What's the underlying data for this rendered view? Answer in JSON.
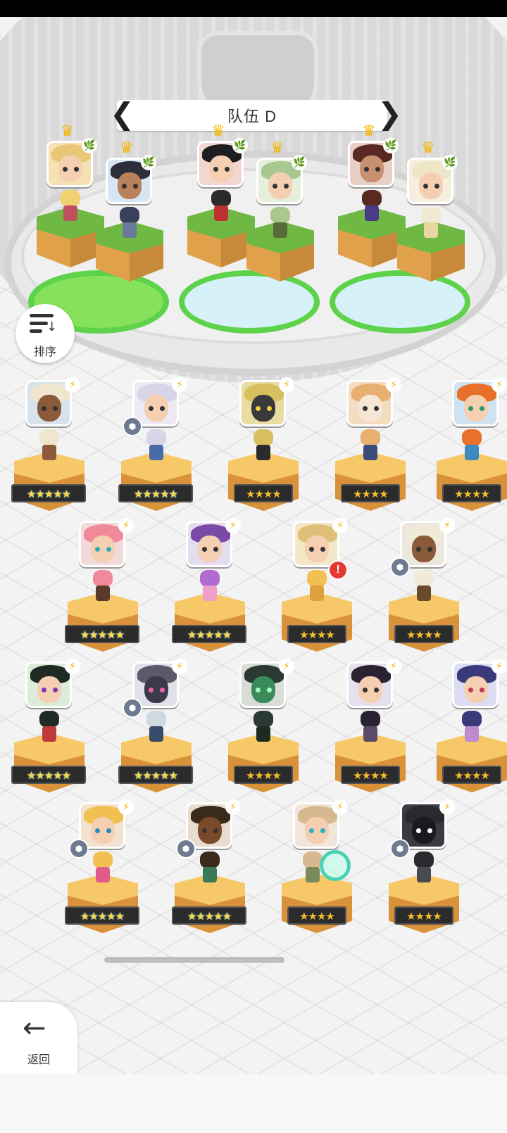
{
  "team": {
    "title": "队伍 D",
    "prev_arrow": "❮",
    "next_arrow": "❯"
  },
  "sort": {
    "label": "排序"
  },
  "back": {
    "label": "返回",
    "icon": "arrow-left"
  },
  "icons": {
    "lightning": "⚡",
    "leaf": "🌿",
    "crown": "♛",
    "class": "⬢",
    "alert": "!"
  },
  "team_slots": [
    {
      "pair": 1,
      "base": "green"
    },
    {
      "pair": 2,
      "base": "blue"
    },
    {
      "pair": 3,
      "base": "blue"
    }
  ],
  "roster_rows": [
    {
      "row": 1,
      "stars": [
        "★★★★★",
        "★★★★★",
        "★★★★",
        "★★★★",
        "★★★★"
      ]
    },
    {
      "row": 2,
      "stars": [
        "★★★★★",
        "★★★★★",
        "★★★★",
        "★★★★"
      ]
    },
    {
      "row": 3,
      "stars": [
        "★★★★★",
        "★★★★★",
        "★★★★",
        "★★★★",
        "★★★★"
      ]
    },
    {
      "row": 4,
      "stars": [
        "★★★★★",
        "★★★★★",
        "★★★★",
        "★★★★"
      ]
    }
  ],
  "colors": {
    "accent_green": "#5ed24a",
    "star_gold": "#f6c02a",
    "alert_red": "#e53935"
  }
}
